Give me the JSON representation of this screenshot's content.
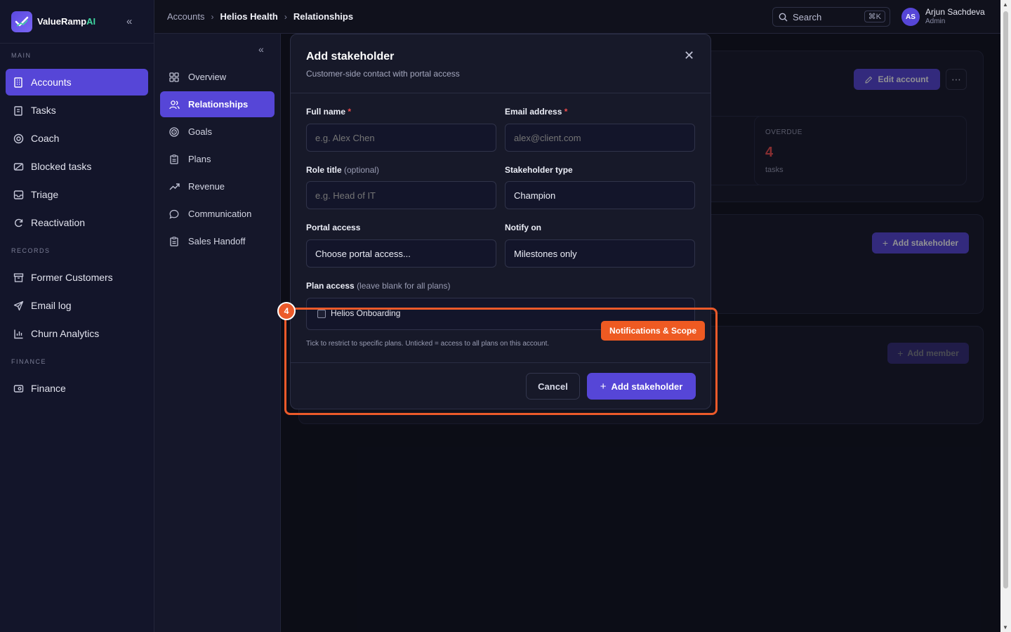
{
  "brand": {
    "name_main": "ValueRamp",
    "name_accent": "AI"
  },
  "sidebar": {
    "sections": [
      {
        "label": "MAIN",
        "items": [
          {
            "label": "Accounts",
            "icon": "building-icon",
            "active": true
          },
          {
            "label": "Tasks",
            "icon": "clipboard-icon"
          },
          {
            "label": "Coach",
            "icon": "target-icon"
          },
          {
            "label": "Blocked tasks",
            "icon": "ban-icon"
          },
          {
            "label": "Triage",
            "icon": "inbox-icon"
          },
          {
            "label": "Reactivation",
            "icon": "refresh-icon"
          }
        ]
      },
      {
        "label": "RECORDS",
        "items": [
          {
            "label": "Former Customers",
            "icon": "archive-icon"
          },
          {
            "label": "Email log",
            "icon": "send-icon"
          },
          {
            "label": "Churn Analytics",
            "icon": "chart-icon"
          }
        ]
      },
      {
        "label": "FINANCE",
        "items": [
          {
            "label": "Finance",
            "icon": "wallet-icon"
          }
        ]
      }
    ]
  },
  "subnav": {
    "items": [
      {
        "label": "Overview",
        "icon": "grid-icon"
      },
      {
        "label": "Relationships",
        "icon": "users-icon",
        "active": true
      },
      {
        "label": "Goals",
        "icon": "target-icon"
      },
      {
        "label": "Plans",
        "icon": "clipboard-icon"
      },
      {
        "label": "Revenue",
        "icon": "trending-up-icon"
      },
      {
        "label": "Communication",
        "icon": "message-icon"
      },
      {
        "label": "Sales Handoff",
        "icon": "clipboard-icon"
      }
    ]
  },
  "topbar": {
    "breadcrumb": [
      "Accounts",
      "Helios Health",
      "Relationships"
    ],
    "search_label": "Search",
    "search_shortcut": "⌘K",
    "user": {
      "initials": "AS",
      "name": "Arjun Sachdeva",
      "role": "Admin"
    }
  },
  "background": {
    "edit_account_label": "Edit account",
    "stat": {
      "label": "OVERDUE",
      "value": "4",
      "unit": "tasks"
    },
    "add_stakeholder_label": "Add stakeholder",
    "add_member_label": "Add member"
  },
  "modal": {
    "title": "Add stakeholder",
    "subtitle": "Customer-side contact with portal access",
    "fields": {
      "full_name": {
        "label": "Full name",
        "required": "*",
        "placeholder": "e.g. Alex Chen"
      },
      "email": {
        "label": "Email address",
        "required": "*",
        "placeholder": "alex@client.com"
      },
      "role_title": {
        "label": "Role title",
        "optional": "(optional)",
        "placeholder": "e.g. Head of IT"
      },
      "stakeholder_type": {
        "label": "Stakeholder type",
        "value": "Champion"
      },
      "portal_access": {
        "label": "Portal access",
        "value": "Choose portal access..."
      },
      "notify_on": {
        "label": "Notify on",
        "value": "Milestones only"
      },
      "plan_access": {
        "label": "Plan access",
        "note": "(leave blank for all plans)",
        "plan_name": "Helios Onboarding",
        "hint": "Tick to restrict to specific plans. Unticked = access to all plans on this account."
      }
    },
    "cancel_label": "Cancel",
    "submit_label": "Add stakeholder"
  },
  "annotation": {
    "step": "4",
    "tag": "Notifications & Scope",
    "color": "#ec5a2a"
  }
}
